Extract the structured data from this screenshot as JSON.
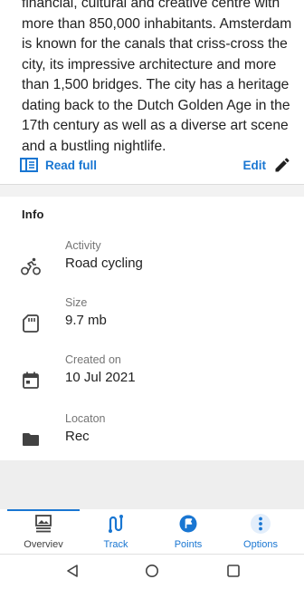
{
  "description": {
    "lines": [
      "financial, cultural and creative centre with",
      "more than 850,000 inhabitants. Amsterdam",
      "is known for the canals that criss-cross the",
      "city, its impressive architecture and more",
      "than 1,500 bridges. The city has a heritage",
      "dating back to the Dutch Golden Age in the",
      "17th century as well as a diverse art scene",
      "and a bustling nightlife."
    ]
  },
  "actions": {
    "read_full": "Read full",
    "edit": "Edit"
  },
  "info": {
    "title": "Info",
    "rows": [
      {
        "label": "Activity",
        "value": "Road cycling",
        "icon": "bicycle-icon"
      },
      {
        "label": "Size",
        "value": "9.7 mb",
        "icon": "sd-card-icon"
      },
      {
        "label": "Created on",
        "value": "10 Jul 2021",
        "icon": "calendar-icon"
      },
      {
        "label": "Locaton",
        "value": "Rec",
        "icon": "folder-icon"
      }
    ]
  },
  "bottom_nav": {
    "items": [
      {
        "label": "Overviev",
        "icon": "overview-icon",
        "selected": true
      },
      {
        "label": "Track",
        "icon": "track-icon"
      },
      {
        "label": "Points",
        "icon": "points-icon"
      },
      {
        "label": "Options",
        "icon": "more-vert-icon"
      }
    ]
  },
  "colors": {
    "accent": "#1976d2",
    "text": "#212121",
    "secondary": "#757575"
  }
}
